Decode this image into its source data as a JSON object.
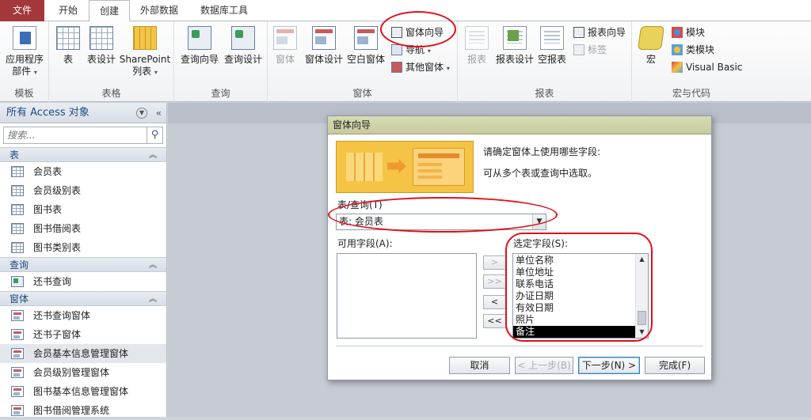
{
  "tabs": [
    "文件",
    "开始",
    "创建",
    "外部数据",
    "数据库工具"
  ],
  "ribbon": {
    "groups": {
      "templates": {
        "label": "模板",
        "app_parts": "应用程序",
        "app_parts2": "部件"
      },
      "tables": {
        "label": "表格",
        "table": "表",
        "table_design": "表设计",
        "sharepoint": "SharePoint",
        "sharepoint2": "列表"
      },
      "queries": {
        "label": "查询",
        "wizard": "查询向导",
        "design": "查询设计"
      },
      "forms": {
        "label": "窗体",
        "form": "窗体",
        "form_design": "窗体设计",
        "blank_form": "空白窗体",
        "form_wizard": "窗体向导",
        "navigation": "导航",
        "more_forms": "其他窗体"
      },
      "reports": {
        "label": "报表",
        "report": "报表",
        "report_design": "报表设计",
        "blank_report": "空报表",
        "report_wizard": "报表向导",
        "labels": "标签"
      },
      "macros": {
        "label": "宏与代码",
        "macro": "宏",
        "module": "模块",
        "class_module": "类模块",
        "visual_basic": "Visual Basic"
      }
    }
  },
  "nav": {
    "title": "所有 Access 对象",
    "search_placeholder": "搜索...",
    "sections": [
      {
        "label": "表",
        "items": [
          "会员表",
          "会员级别表",
          "图书表",
          "图书借阅表",
          "图书类别表"
        ]
      },
      {
        "label": "查询",
        "items": [
          "还书查询"
        ]
      },
      {
        "label": "窗体",
        "items": [
          "还书查询窗体",
          "还书子窗体",
          "会员基本信息管理窗体",
          "会员级别管理窗体",
          "图书基本信息管理窗体",
          "图书借阅管理系统"
        ]
      }
    ]
  },
  "dialog": {
    "title": "窗体向导",
    "prompt1": "请确定窗体上使用哪些字段:",
    "prompt2": "可从多个表或查询中选取。",
    "table_label": "表/查询(T)",
    "table_value": "表: 会员表",
    "available_label": "可用字段(A):",
    "selected_label": "选定字段(S):",
    "selected_fields": [
      "单位名称",
      "单位地址",
      "联系电话",
      "办证日期",
      "有效日期",
      "照片",
      "备注"
    ],
    "move_buttons": [
      ">",
      ">>",
      "<",
      "<<"
    ],
    "buttons": {
      "cancel": "取消",
      "back": "< 上一步(B)",
      "next": "下一步(N) >",
      "finish": "完成(F)"
    }
  }
}
